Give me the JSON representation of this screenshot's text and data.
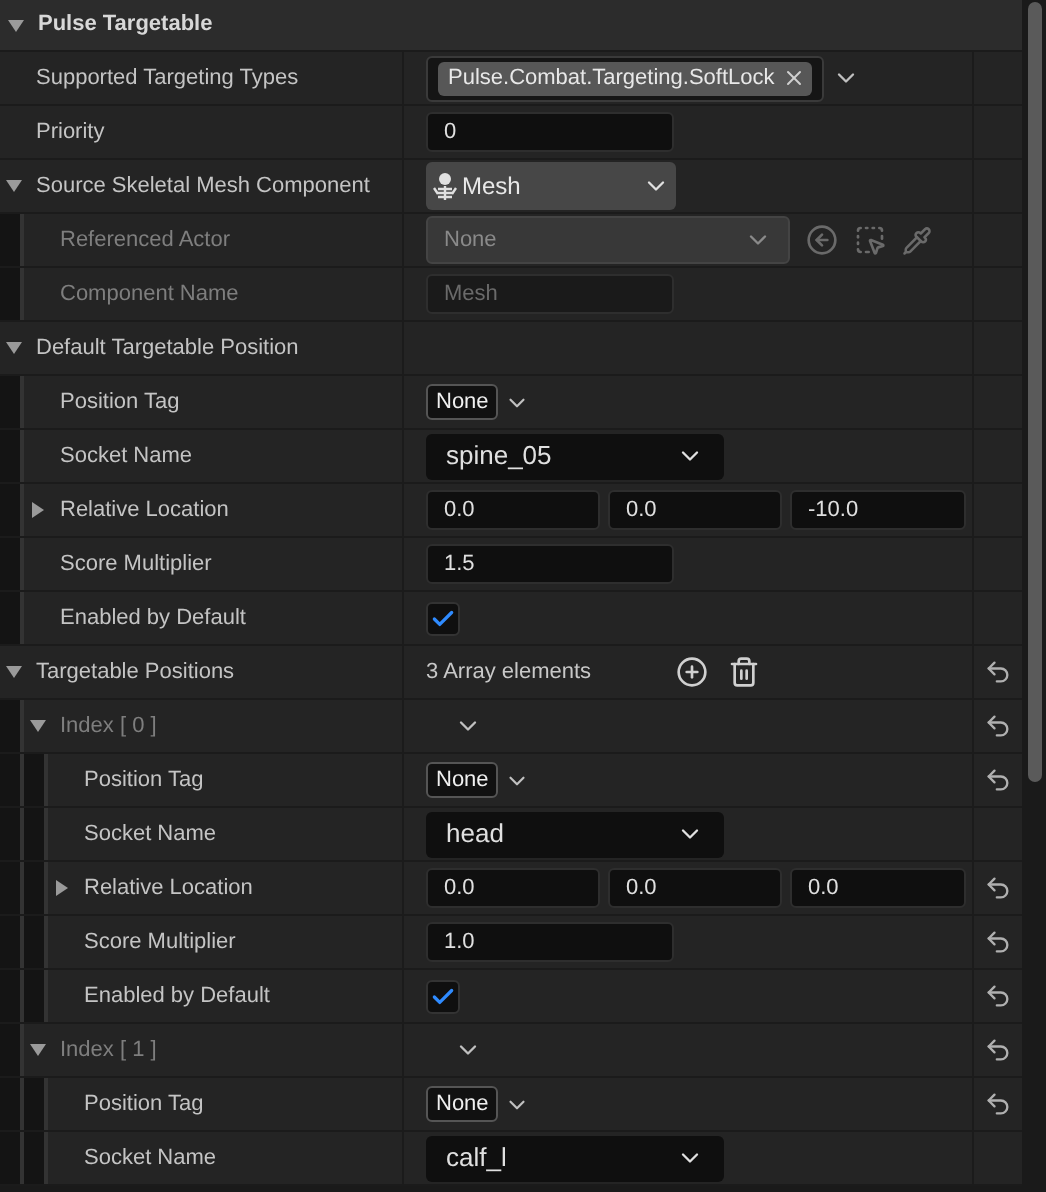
{
  "category": {
    "title": "Pulse Targetable",
    "expanded": true
  },
  "properties": [
    {
      "label": "Supported Targeting Types",
      "kind": "tags",
      "tags": [
        "Pulse.Combat.Targeting.SoftLock"
      ]
    },
    {
      "label": "Priority",
      "kind": "number",
      "value": "0"
    },
    {
      "label": "Source Skeletal Mesh Component",
      "kind": "component",
      "value": "Mesh",
      "expanded": true,
      "children": [
        {
          "label": "Referenced Actor",
          "kind": "actor",
          "value": "None",
          "disabled": true
        },
        {
          "label": "Component Name",
          "kind": "text",
          "value": "Mesh",
          "disabled": true
        }
      ]
    },
    {
      "label": "Default Targetable Position",
      "kind": "struct",
      "expanded": true,
      "children": [
        {
          "label": "Position Tag",
          "kind": "tag",
          "value": "None"
        },
        {
          "label": "Socket Name",
          "kind": "combo",
          "value": "spine_05"
        },
        {
          "label": "Relative Location",
          "kind": "vector",
          "expanded": false,
          "values": [
            "0.0",
            "0.0",
            "-10.0"
          ]
        },
        {
          "label": "Score Multiplier",
          "kind": "number",
          "value": "1.5"
        },
        {
          "label": "Enabled by Default",
          "kind": "checkbox",
          "checked": true
        }
      ]
    },
    {
      "label": "Targetable Positions",
      "kind": "array",
      "count": "3 Array elements",
      "expanded": true,
      "resettable": true,
      "children": [
        {
          "label": "Index [ 0 ]",
          "kind": "index",
          "expanded": true,
          "resettable": true,
          "children": [
            {
              "label": "Position Tag",
              "kind": "tag",
              "value": "None",
              "resettable": true
            },
            {
              "label": "Socket Name",
              "kind": "combo",
              "value": "head"
            },
            {
              "label": "Relative Location",
              "kind": "vector",
              "expanded": false,
              "values": [
                "0.0",
                "0.0",
                "0.0"
              ],
              "resettable": true
            },
            {
              "label": "Score Multiplier",
              "kind": "number",
              "value": "1.0",
              "resettable": true
            },
            {
              "label": "Enabled by Default",
              "kind": "checkbox",
              "checked": true,
              "resettable": true
            }
          ]
        },
        {
          "label": "Index [ 1 ]",
          "kind": "index",
          "expanded": true,
          "resettable": true,
          "children": [
            {
              "label": "Position Tag",
              "kind": "tag",
              "value": "None",
              "resettable": true
            },
            {
              "label": "Socket Name",
              "kind": "combo",
              "value": "calf_l"
            }
          ]
        }
      ]
    }
  ]
}
